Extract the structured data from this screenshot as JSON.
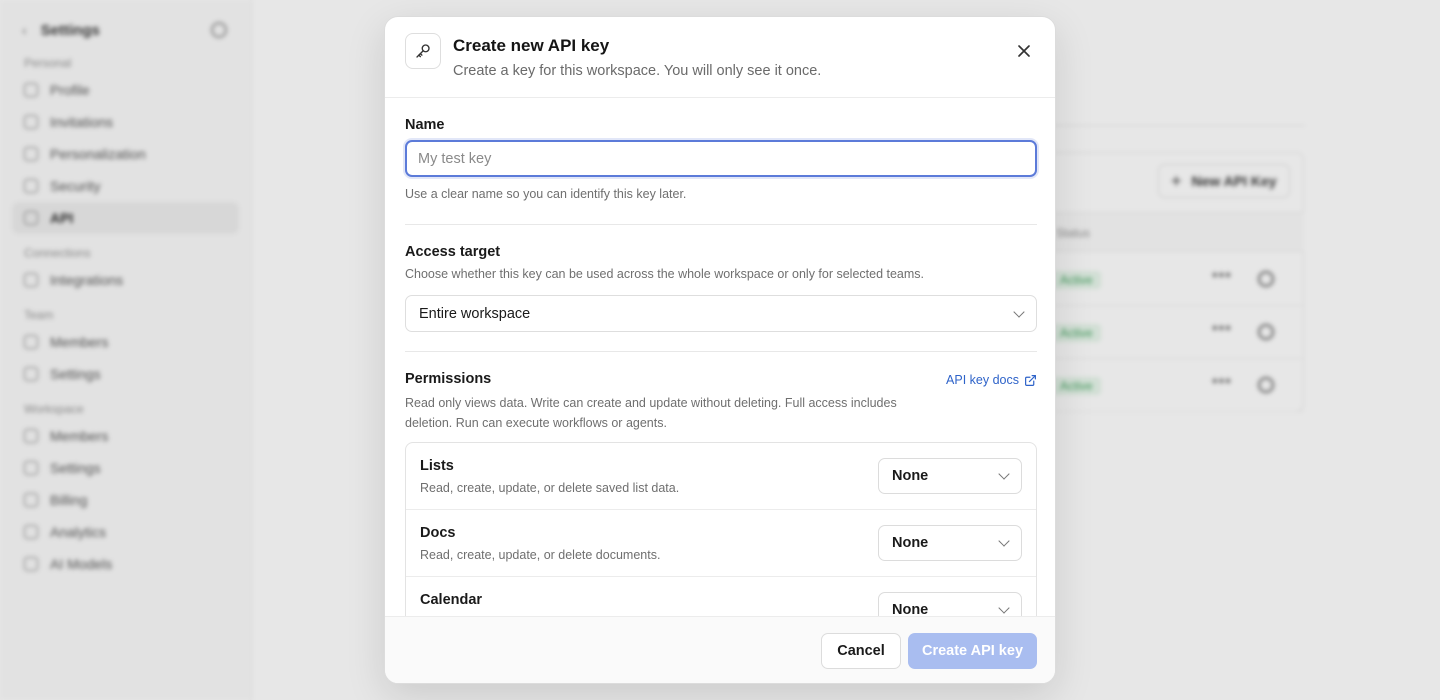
{
  "background": {
    "sidebar": {
      "title": "Settings",
      "sections": [
        {
          "label": "Personal",
          "items": [
            "Profile",
            "Invitations",
            "Personalization",
            "Security",
            "API"
          ]
        },
        {
          "label": "Connections",
          "items": [
            "Integrations"
          ]
        },
        {
          "label": "Team",
          "items": [
            "Members",
            "Settings"
          ]
        },
        {
          "label": "Workspace",
          "items": [
            "Members",
            "Settings",
            "Billing",
            "Analytics",
            "AI Models"
          ]
        }
      ],
      "active_item": "API"
    },
    "main": {
      "new_key_label": "New API Key",
      "table_header": "Status",
      "rows": [
        {
          "status": "Active"
        },
        {
          "status": "Active"
        },
        {
          "status": "Active"
        }
      ]
    }
  },
  "modal": {
    "title": "Create new API key",
    "subtitle": "Create a key for this workspace. You will only see it once.",
    "name_field": {
      "label": "Name",
      "placeholder": "My test key",
      "value": "",
      "hint": "Use a clear name so you can identify this key later."
    },
    "access_target": {
      "label": "Access target",
      "description": "Choose whether this key can be used across the whole workspace or only for selected teams.",
      "selected": "Entire workspace"
    },
    "permissions": {
      "label": "Permissions",
      "description": "Read only views data. Write can create and update without deleting. Full access includes deletion. Run can execute workflows or agents.",
      "docs_link": "API key docs",
      "rows": [
        {
          "title": "Lists",
          "description": "Read, create, update, or delete saved list data.",
          "value": "None"
        },
        {
          "title": "Docs",
          "description": "Read, create, update, or delete documents.",
          "value": "None"
        },
        {
          "title": "Calendar",
          "description": "",
          "value": "None"
        }
      ]
    },
    "footer": {
      "cancel_label": "Cancel",
      "create_label": "Create API key"
    }
  }
}
